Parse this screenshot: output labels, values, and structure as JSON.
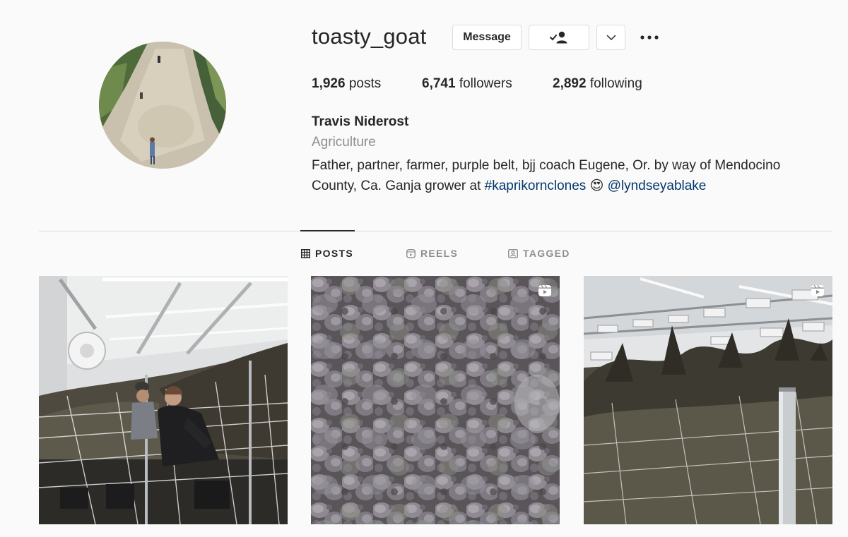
{
  "profile": {
    "username": "toasty_goat",
    "message_label": "Message",
    "posts_count": "1,926",
    "posts_label": "posts",
    "followers_count": "6,741",
    "followers_label": "followers",
    "following_count": "2,892",
    "following_label": "following",
    "full_name": "Travis Niderost",
    "category": "Agriculture",
    "bio_text": "Father, partner, farmer, purple belt, bjj coach Eugene, Or. by way of Mendocino County, Ca. Ganja grower at ",
    "bio_hashtag": "#kaprikornclones",
    "bio_emoji": "😍",
    "bio_mention": "@lyndseyablake"
  },
  "tabs": [
    {
      "label": "POSTS",
      "icon": "grid-icon",
      "active": true
    },
    {
      "label": "REELS",
      "icon": "reels-icon",
      "active": false
    },
    {
      "label": "TAGGED",
      "icon": "tagged-icon",
      "active": false
    }
  ],
  "posts": [
    {
      "subject": "grow-room-with-two-people",
      "reel": false
    },
    {
      "subject": "purple-cannabis-buds-closeup",
      "reel": true
    },
    {
      "subject": "cannabis-plants-under-lights",
      "reel": true
    }
  ],
  "colors": {
    "background": "#fafafa",
    "text": "#262626",
    "muted": "#8e8e8e",
    "link": "#00376b",
    "border": "#dbdbdb"
  }
}
